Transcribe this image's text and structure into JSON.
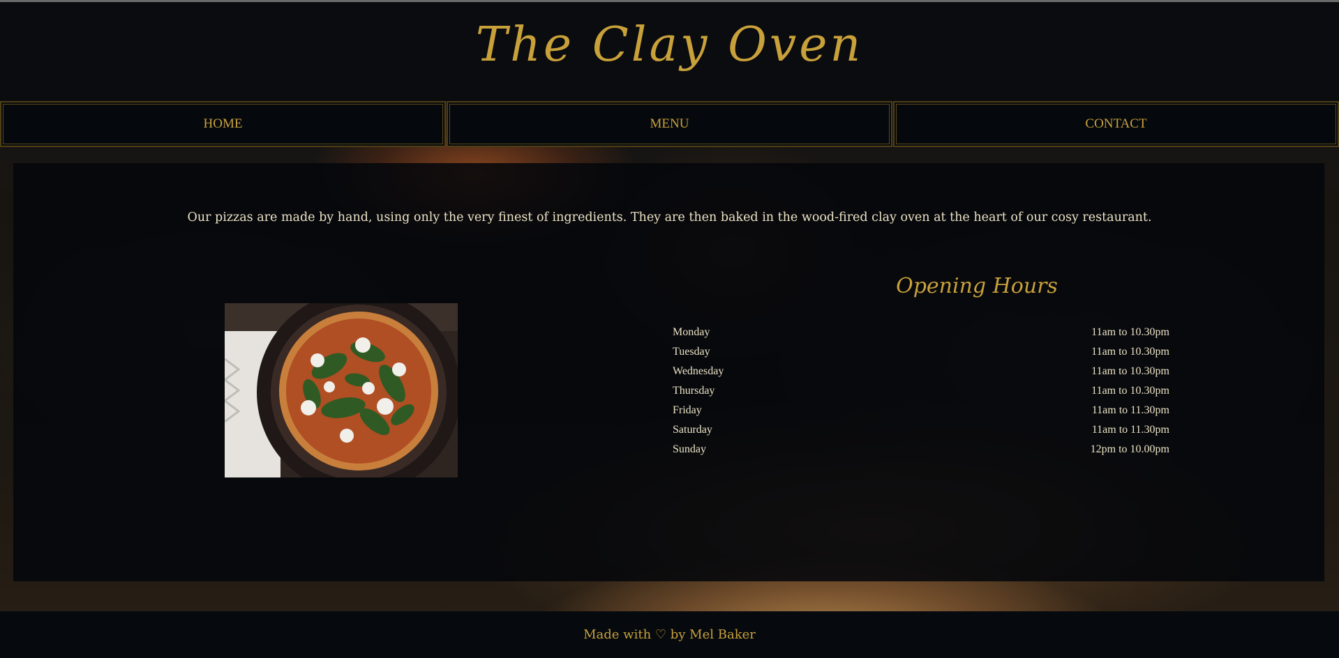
{
  "site": {
    "title": "The Clay Oven"
  },
  "nav": {
    "items": [
      {
        "label": "HOME"
      },
      {
        "label": "MENU"
      },
      {
        "label": "CONTACT"
      }
    ]
  },
  "intro": "Our pizzas are made by hand, using only the very finest of ingredients. They are then baked in the wood-fired clay oven at the heart of our cosy restaurant.",
  "hours": {
    "title": "Opening Hours",
    "rows": [
      {
        "day": "Monday",
        "time": "11am to 10.30pm"
      },
      {
        "day": "Tuesday",
        "time": "11am to 10.30pm"
      },
      {
        "day": "Wednesday",
        "time": "11am to 10.30pm"
      },
      {
        "day": "Thursday",
        "time": "11am to 10.30pm"
      },
      {
        "day": "Friday",
        "time": "11am to 11.30pm"
      },
      {
        "day": "Saturday",
        "time": "11am to 11.30pm"
      },
      {
        "day": "Sunday",
        "time": "12pm to 10.00pm"
      }
    ]
  },
  "footer": {
    "text": "Made with ♡ by Mel Baker"
  },
  "colors": {
    "accent": "#c9a13b",
    "text": "#ece3c6",
    "panel": "#04070b"
  }
}
